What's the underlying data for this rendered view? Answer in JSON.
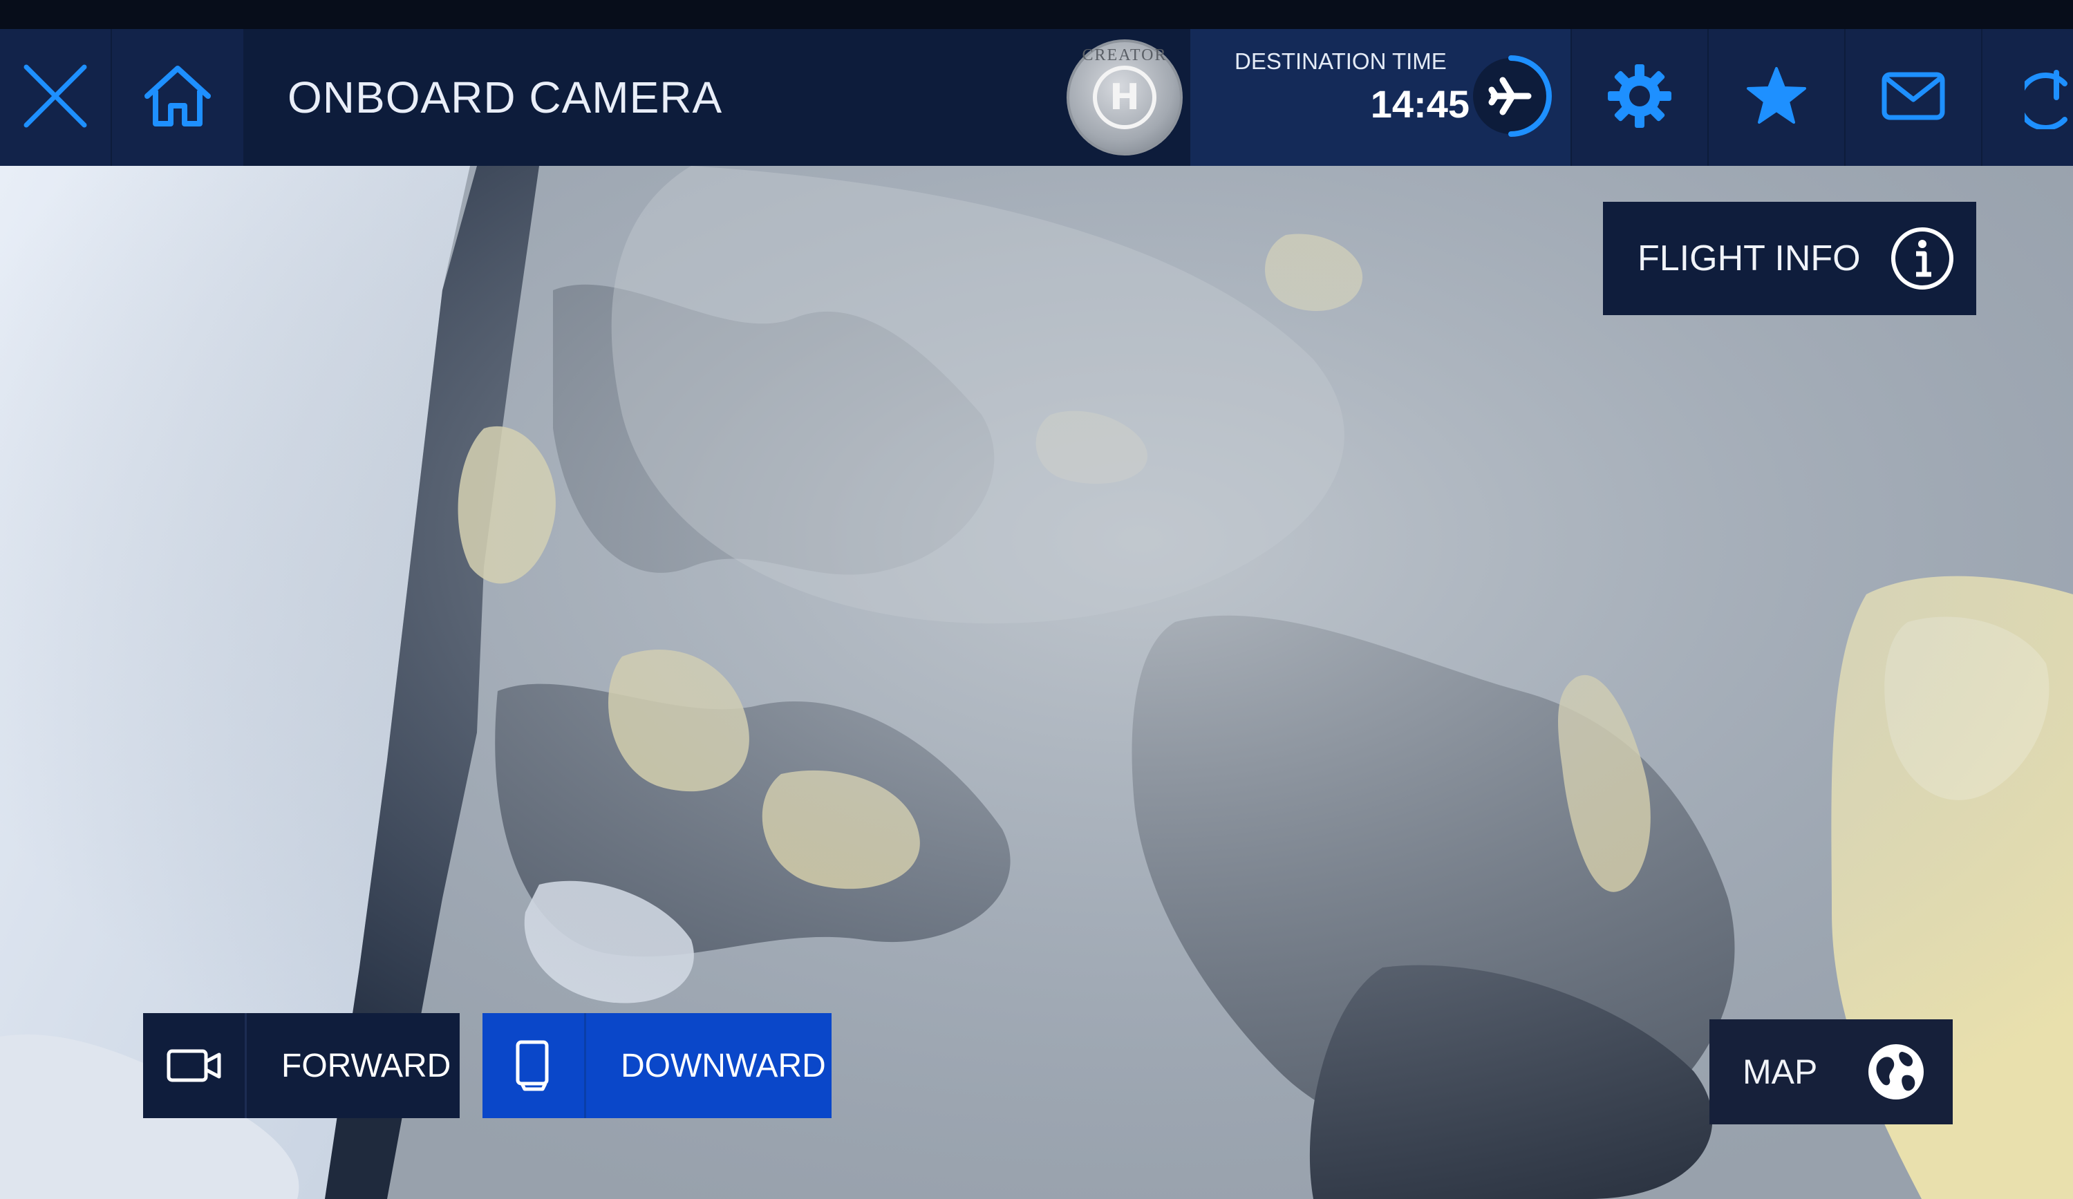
{
  "header": {
    "title": "ONBOARD CAMERA",
    "avatar_text": "CREATOR",
    "avatar_letter": "H",
    "destination_label": "DESTINATION TIME",
    "destination_time": "14:45"
  },
  "overlay": {
    "flight_info_label": "FLIGHT INFO",
    "map_label": "MAP"
  },
  "camera_views": {
    "forward_label": "FORWARD",
    "downward_label": "DOWNWARD",
    "selected": "DOWNWARD"
  },
  "icons": {
    "close": "close-icon",
    "home": "home-icon",
    "plane": "plane-progress-icon",
    "settings": "gear-icon",
    "favorites": "star-icon",
    "messages": "mail-icon",
    "power": "power-icon",
    "info": "info-icon",
    "video": "video-camera-icon",
    "downward": "tablet-icon",
    "globe": "globe-icon"
  },
  "colors": {
    "accent_blue": "#1e90ff",
    "selected_button": "#0a47c9",
    "bar_background": "#0d1c3b"
  }
}
